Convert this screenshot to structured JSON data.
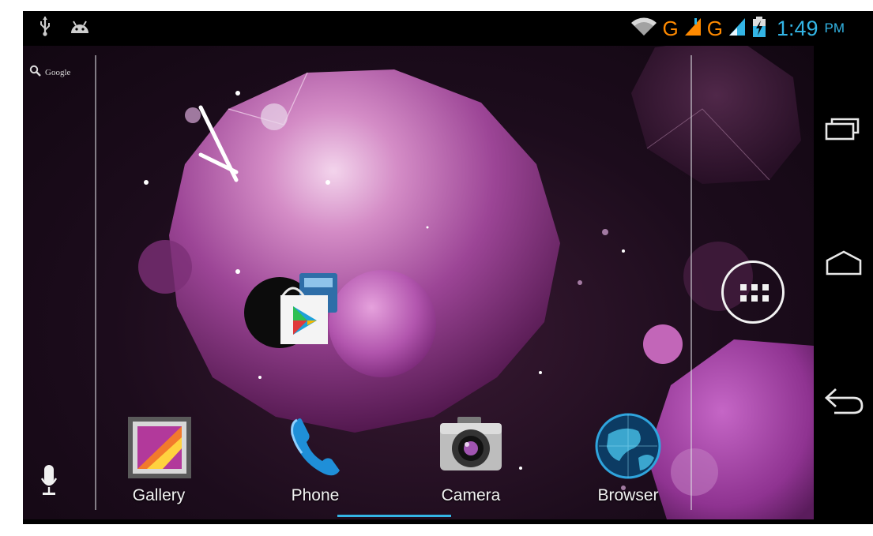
{
  "status_bar": {
    "left_icons": [
      "usb-icon",
      "android-debug-icon"
    ],
    "right_icons": [
      "wifi-icon",
      "signal-sim1-icon",
      "signal-sim2-icon",
      "battery-charging-icon"
    ],
    "network_sim1": "G",
    "network_sim2": "G",
    "time": "1:49",
    "ampm": "PM"
  },
  "search": {
    "label": "Google",
    "search_icon": "search-icon",
    "voice_icon": "mic-icon"
  },
  "dock": {
    "items": [
      {
        "label": "Gallery",
        "icon": "gallery-icon"
      },
      {
        "label": "Phone",
        "icon": "phone-icon"
      },
      {
        "label": "Camera",
        "icon": "camera-icon"
      },
      {
        "label": "Browser",
        "icon": "browser-icon"
      }
    ]
  },
  "navigation": {
    "buttons": [
      "recents-icon",
      "home-icon",
      "back-icon"
    ]
  },
  "widgets": {
    "clock": "analog-clock-widget",
    "play_store": "play-store-icon"
  },
  "colors": {
    "accent": "#33b5e5",
    "network": "#ff8a00",
    "wallpaper": "#6a2a60"
  }
}
